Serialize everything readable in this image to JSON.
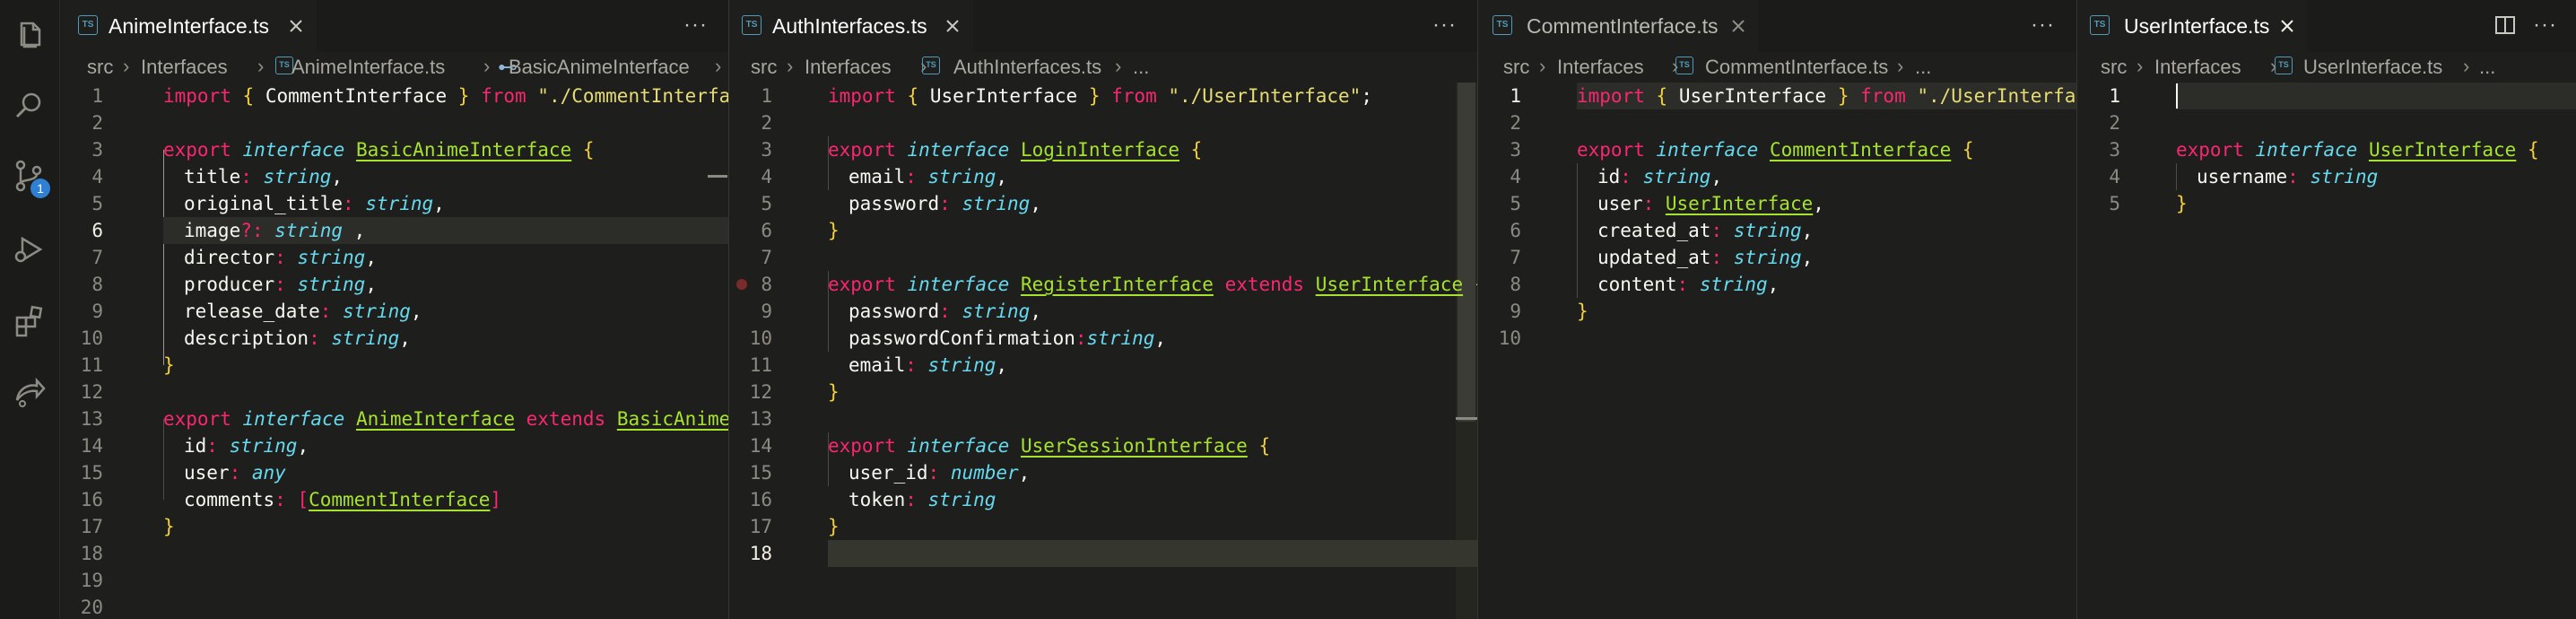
{
  "activity_bar": {
    "icons": [
      "files-icon",
      "search-icon",
      "source-control-icon",
      "run-debug-icon",
      "extensions-icon",
      "remote-explorer-icon"
    ],
    "scm_badge": "1"
  },
  "panes": [
    {
      "tab": {
        "name": "AnimeInterface.ts",
        "icon": "TS"
      },
      "breadcrumb": [
        "src",
        "Interfaces",
        "AnimeInterface.ts",
        "BasicAnimeInterface"
      ],
      "line_numbers": [
        "1",
        "2",
        "3",
        "4",
        "5",
        "6",
        "7",
        "8",
        "9",
        "10",
        "11",
        "12",
        "13",
        "14",
        "15",
        "16",
        "17",
        "18",
        "19",
        "20"
      ],
      "current_line": "6"
    },
    {
      "tab": {
        "name": "AuthInterfaces.ts",
        "icon": "TS"
      },
      "breadcrumb": [
        "src",
        "Interfaces",
        "AuthInterfaces.ts",
        "..."
      ],
      "line_numbers": [
        "1",
        "2",
        "3",
        "4",
        "5",
        "6",
        "7",
        "8",
        "9",
        "10",
        "11",
        "12",
        "13",
        "14",
        "15",
        "16",
        "17",
        "18"
      ],
      "current_line": "18"
    },
    {
      "tab": {
        "name": "CommentInterface.ts",
        "icon": "TS"
      },
      "breadcrumb": [
        "src",
        "Interfaces",
        "CommentInterface.ts",
        "..."
      ],
      "line_numbers": [
        "1",
        "2",
        "3",
        "4",
        "5",
        "6",
        "7",
        "8",
        "9",
        "10"
      ],
      "current_line": "1"
    },
    {
      "tab": {
        "name": "UserInterface.ts",
        "icon": "TS"
      },
      "breadcrumb": [
        "src",
        "Interfaces",
        "UserInterface.ts",
        "..."
      ],
      "line_numbers": [
        "1",
        "2",
        "3",
        "4",
        "5"
      ],
      "current_line": "1"
    }
  ],
  "code": {
    "anime": {
      "l1": [
        "import",
        " ",
        "{",
        " CommentInterface ",
        "}",
        " ",
        "from",
        " ",
        "\"./CommentInterface\""
      ],
      "l3": [
        "export",
        " ",
        "interface",
        " ",
        "BasicAnimeInterface",
        " ",
        "{"
      ],
      "l4": [
        "title",
        ": ",
        "string",
        ","
      ],
      "l5": [
        "original_title",
        ": ",
        "string",
        ","
      ],
      "l6": [
        "image",
        "?:",
        " ",
        "string",
        " ,"
      ],
      "l7": [
        "director",
        ": ",
        "string",
        ","
      ],
      "l8": [
        "producer",
        ": ",
        "string",
        ","
      ],
      "l9": [
        "release_date",
        ": ",
        "string",
        ","
      ],
      "l10": [
        "description",
        ": ",
        "string",
        ","
      ],
      "l11": [
        "}"
      ],
      "l13": [
        "export",
        " ",
        "interface",
        " ",
        "AnimeInterface",
        " ",
        "extends",
        " ",
        "BasicAnimeInterface"
      ],
      "l14": [
        "id",
        ": ",
        "string",
        ","
      ],
      "l15": [
        "user",
        ": ",
        "any"
      ],
      "l16": [
        "comments",
        ": ",
        "[",
        "CommentInterface",
        "]"
      ],
      "l17": [
        "}"
      ]
    },
    "auth": {
      "l1": [
        "import",
        " ",
        "{",
        " UserInterface ",
        "}",
        " ",
        "from",
        " ",
        "\"./UserInterface\"",
        ";"
      ],
      "l3": [
        "export",
        " ",
        "interface",
        " ",
        "LoginInterface",
        " ",
        "{"
      ],
      "l4": [
        "email",
        ": ",
        "string",
        ","
      ],
      "l5": [
        "password",
        ": ",
        "string",
        ","
      ],
      "l6": [
        "}"
      ],
      "l8": [
        "export",
        " ",
        "interface",
        " ",
        "RegisterInterface",
        " ",
        "extends",
        " ",
        "UserInterface",
        " ",
        "{"
      ],
      "l9": [
        "password",
        ": ",
        "string",
        ","
      ],
      "l10": [
        "passwordConfirmation",
        ":",
        "string",
        ","
      ],
      "l11": [
        "email",
        ": ",
        "string",
        ","
      ],
      "l12": [
        "}"
      ],
      "l14": [
        "export",
        " ",
        "interface",
        " ",
        "UserSessionInterface",
        " ",
        "{"
      ],
      "l15": [
        "user_id",
        ": ",
        "number",
        ","
      ],
      "l16": [
        "token",
        ": ",
        "string"
      ],
      "l17": [
        "}"
      ]
    },
    "comment": {
      "l1": [
        "import",
        " ",
        "{",
        " UserInterface ",
        "}",
        " ",
        "from",
        " ",
        "\"./UserInterface\""
      ],
      "l3": [
        "export",
        " ",
        "interface",
        " ",
        "CommentInterface",
        " ",
        "{"
      ],
      "l4": [
        "id",
        ": ",
        "string",
        ","
      ],
      "l5": [
        "user",
        ": ",
        "UserInterface",
        ","
      ],
      "l6": [
        "created_at",
        ": ",
        "string",
        ","
      ],
      "l7": [
        "updated_at",
        ": ",
        "string",
        ","
      ],
      "l8": [
        "content",
        ": ",
        "string",
        ","
      ],
      "l9": [
        "}"
      ]
    },
    "user": {
      "l3": [
        "export",
        " ",
        "interface",
        " ",
        "UserInterface",
        " ",
        "{"
      ],
      "l4": [
        "username",
        ": ",
        "string"
      ],
      "l5": [
        "}"
      ]
    }
  },
  "colors": {
    "keyword": "#f92672",
    "type": "#66d9ef",
    "bracket": "#f4d03f",
    "string": "#e6db74",
    "name": "#a6e22e",
    "text": "#f8f8f2",
    "background": "#1e1f1c"
  },
  "toolbar": {
    "more_label": "···"
  }
}
